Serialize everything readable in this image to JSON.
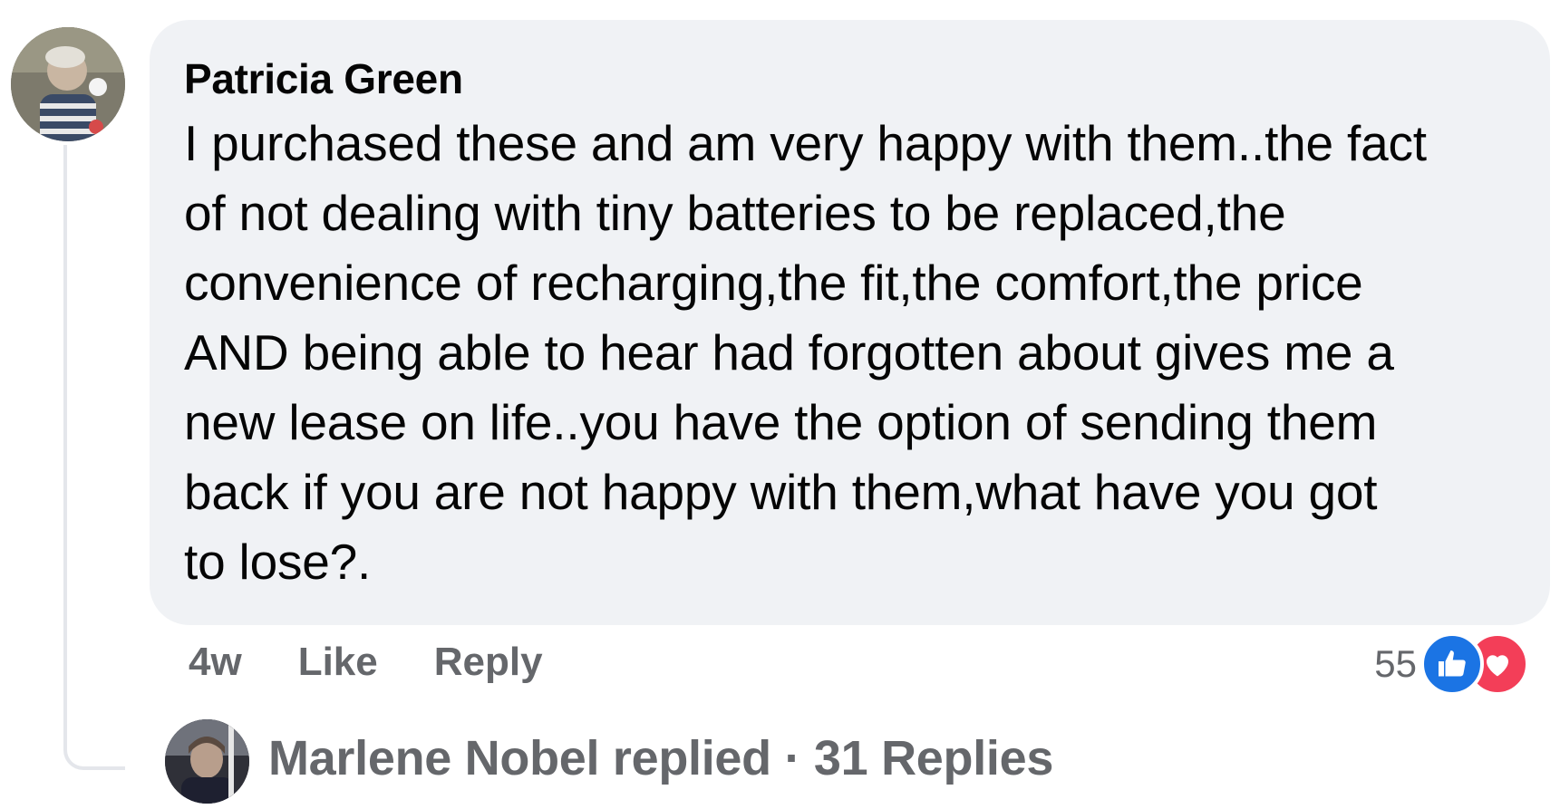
{
  "comment": {
    "author": "Patricia Green",
    "lines": [
      "I purchased these and am very happy with them..the fact",
      "of not dealing with tiny batteries to be replaced,the",
      "convenience of recharging,the fit,the comfort,the price",
      "AND being able to hear had forgotten about gives me a",
      "new lease on life..you have the option of sending them",
      "back if you are not happy with them,what have you got",
      "to lose?."
    ],
    "avatar_icon": "user-avatar-photo"
  },
  "actions": {
    "time": "4w",
    "like_label": "Like",
    "reply_label": "Reply"
  },
  "reactions": {
    "count": "55",
    "icons": [
      "like-icon",
      "love-icon"
    ],
    "like_color": "#1b74e4",
    "love_color": "#f33e58"
  },
  "replies": {
    "summary": "Marlene Nobel replied · 31 Replies",
    "avatar_icon": "user-avatar-photo"
  },
  "colors": {
    "bubble_bg": "#f0f2f5",
    "secondary_text": "#65676b",
    "primary_text": "#050505"
  }
}
